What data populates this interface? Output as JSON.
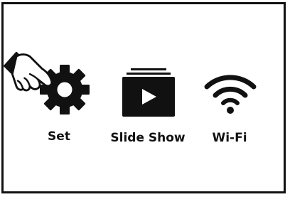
{
  "menu": {
    "items": [
      {
        "label": "Set",
        "icon": "gear-icon",
        "selected": true
      },
      {
        "label": "Slide Show",
        "icon": "slideshow-icon",
        "selected": false
      },
      {
        "label": "Wi-Fi",
        "icon": "wifi-icon",
        "selected": false
      }
    ],
    "pointer_icon": "pointing-hand-icon"
  },
  "colors": {
    "foreground": "#111111",
    "background": "#ffffff",
    "play_glyph": "#ffffff"
  }
}
